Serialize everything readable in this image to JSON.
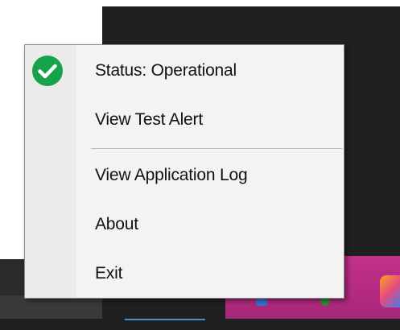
{
  "menu": {
    "items": [
      {
        "label": "Status: Operational",
        "icon": "check-circle-icon",
        "icon_color": "#16a34a"
      },
      {
        "label": "View Test Alert"
      },
      {
        "label": "View Application Log"
      },
      {
        "label": "About"
      },
      {
        "label": "Exit"
      }
    ]
  },
  "colors": {
    "menu_background": "#f3f3f3",
    "status_ok": "#16a34a",
    "taskbar_accent": "#c2318a"
  }
}
